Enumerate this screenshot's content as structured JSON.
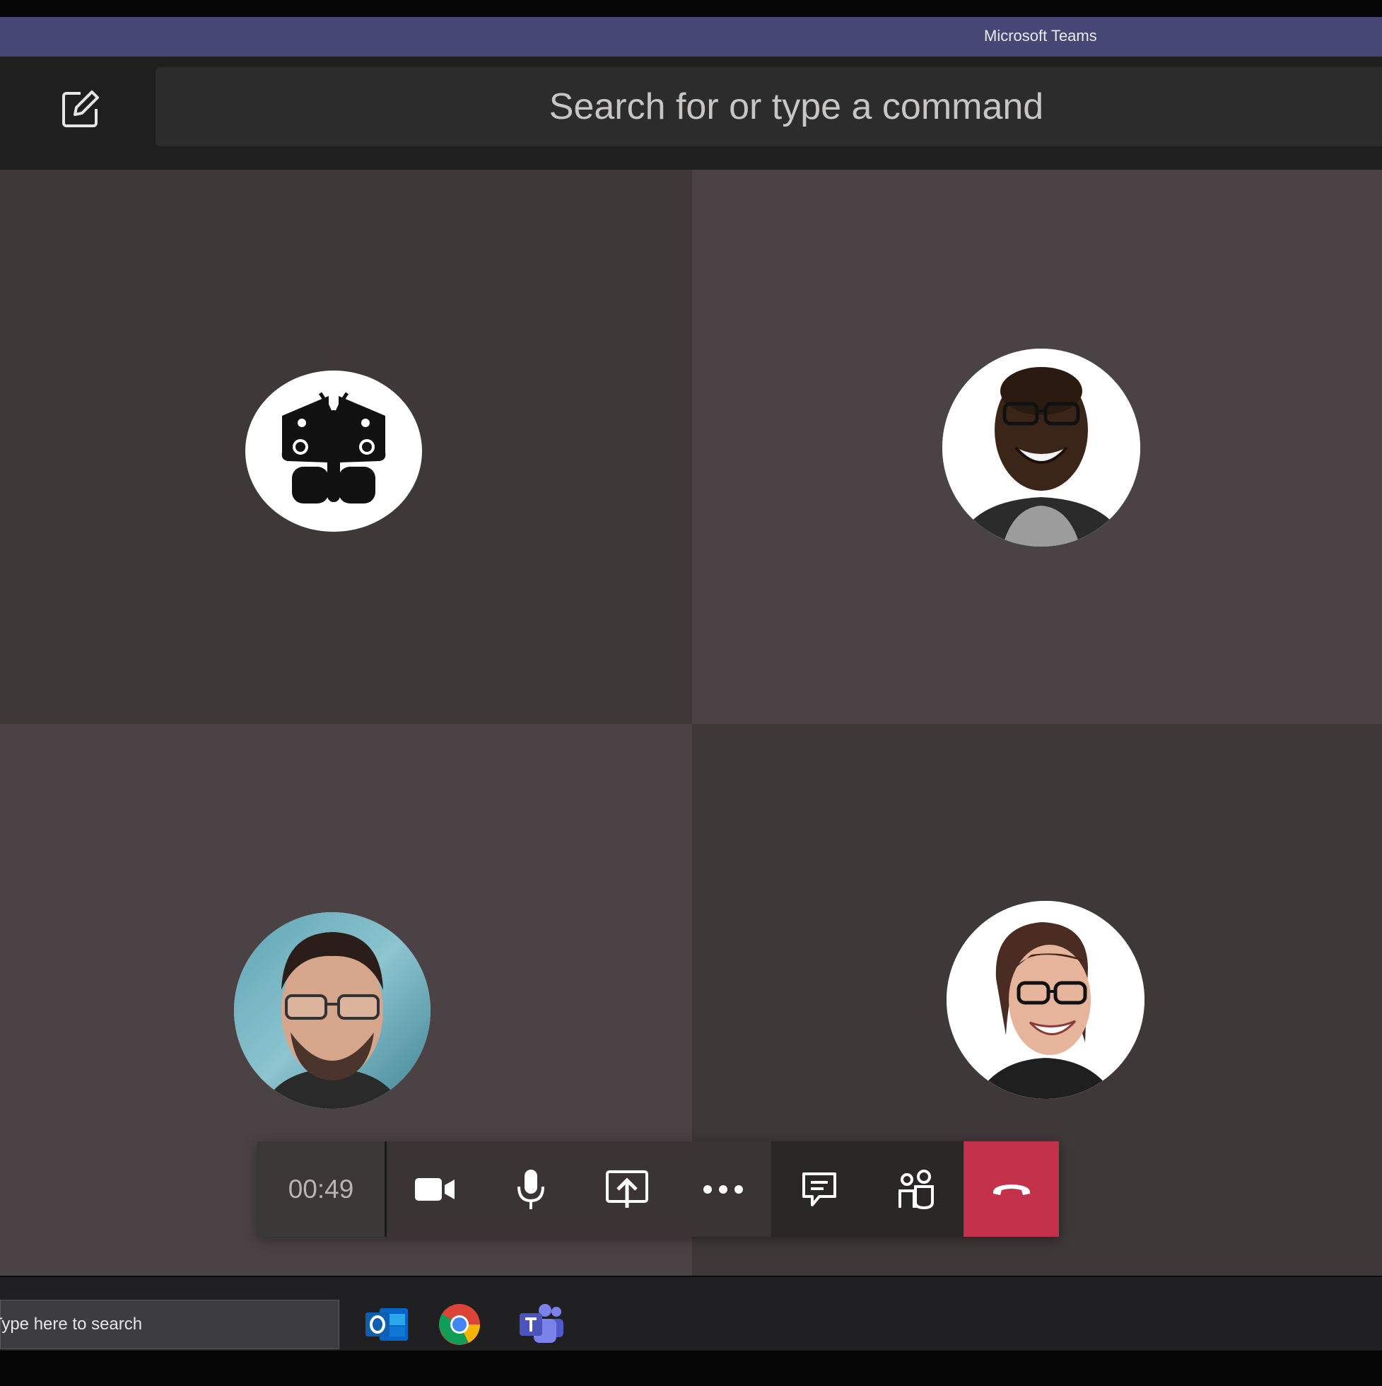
{
  "window": {
    "title": "Microsoft Teams"
  },
  "header": {
    "search_placeholder": "Search for or type a command",
    "compose_icon": "compose-icon"
  },
  "participants": [
    {
      "avatar": "butterfly-logo"
    },
    {
      "avatar": "smiling-man-glasses-photo"
    },
    {
      "avatar": "man-glasses-photo"
    },
    {
      "avatar": "smiling-woman-glasses-photo"
    }
  ],
  "call_controls": {
    "timer": "00:49",
    "buttons": [
      "video-camera-icon",
      "microphone-icon",
      "share-screen-icon",
      "more-options-icon",
      "chat-icon",
      "participants-icon",
      "hang-up-icon"
    ],
    "hangup_color": "#c4314b"
  },
  "taskbar": {
    "search_placeholder": "Type here to search",
    "apps": [
      "outlook-icon",
      "chrome-icon",
      "teams-icon"
    ]
  },
  "colors": {
    "titlebar": "#464775",
    "tile_dark": "#3e3838",
    "tile_light": "#4b4245"
  }
}
